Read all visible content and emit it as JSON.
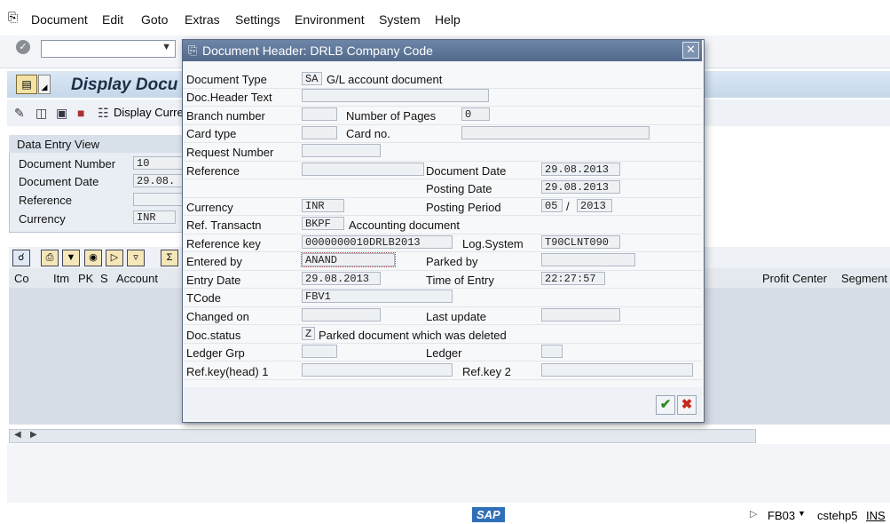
{
  "menu": {
    "items": [
      "Document",
      "Edit",
      "Goto",
      "Extras",
      "Settings",
      "Environment",
      "System",
      "Help"
    ]
  },
  "background": {
    "title": "Display Docu",
    "toolbar_display_currency": "Display Curre",
    "panel_title": "Data Entry View",
    "labels": [
      "Document Number",
      "Document Date",
      "Reference",
      "Currency"
    ],
    "values": [
      "10",
      "29.08.",
      "",
      "INR"
    ],
    "grid_columns": [
      "Co",
      "Itm",
      "PK",
      "S",
      "Account",
      "Profit Center",
      "Segment"
    ]
  },
  "status": {
    "tcode": "FB03",
    "server": "cstehp5",
    "mode": "INS",
    "sap_logo": "SAP"
  },
  "dialog": {
    "title": "Document Header: DRLB Company Code",
    "fields": {
      "document_type_label": "Document Type",
      "document_type_value": "SA",
      "document_type_desc": "G/L account document",
      "doc_header_text_label": "Doc.Header Text",
      "doc_header_text_value": "",
      "branch_number_label": "Branch number",
      "branch_number_value": "",
      "number_of_pages_label": "Number of Pages",
      "number_of_pages_value": "0",
      "card_type_label": "Card type",
      "card_type_value": "",
      "card_no_label": "Card no.",
      "card_no_value": "",
      "request_number_label": "Request Number",
      "request_number_value": "",
      "reference_label": "Reference",
      "reference_value": "",
      "document_date_label": "Document Date",
      "document_date_value": "29.08.2013",
      "posting_date_label": "Posting Date",
      "posting_date_value": "29.08.2013",
      "currency_label": "Currency",
      "currency_value": "INR",
      "posting_period_label": "Posting Period",
      "posting_period_month": "05",
      "posting_period_sep": "/",
      "posting_period_year": "2013",
      "ref_transactn_label": "Ref. Transactn",
      "ref_transactn_value": "BKPF",
      "ref_transactn_desc": "Accounting document",
      "reference_key_label": "Reference key",
      "reference_key_value": "0000000010DRLB2013",
      "log_system_label": "Log.System",
      "log_system_value": "T90CLNT090",
      "entered_by_label": "Entered by",
      "entered_by_value": "ANAND",
      "parked_by_label": "Parked by",
      "parked_by_value": "",
      "entry_date_label": "Entry Date",
      "entry_date_value": "29.08.2013",
      "time_of_entry_label": "Time of Entry",
      "time_of_entry_value": "22:27:57",
      "tcode_label": "TCode",
      "tcode_value": "FBV1",
      "changed_on_label": "Changed on",
      "changed_on_value": "",
      "last_update_label": "Last update",
      "last_update_value": "",
      "doc_status_label": "Doc.status",
      "doc_status_value": "Z",
      "doc_status_desc": "Parked document which was deleted",
      "ledger_grp_label": "Ledger Grp",
      "ledger_grp_value": "",
      "ledger_label": "Ledger",
      "ledger_value": "",
      "ref_key_head1_label": "Ref.key(head) 1",
      "ref_key_head1_value": "",
      "ref_key2_label": "Ref.key 2",
      "ref_key2_value": ""
    },
    "ok_icon": "checkmark-icon",
    "cancel_icon": "cancel-icon"
  },
  "colors": {
    "dialog_title_bg": "#5b7294",
    "title_bar_bg": "#cfdeee",
    "grid_body_bg": "#d6dde6",
    "ok_green": "#2f8a22",
    "cancel_red": "#c8271c"
  }
}
